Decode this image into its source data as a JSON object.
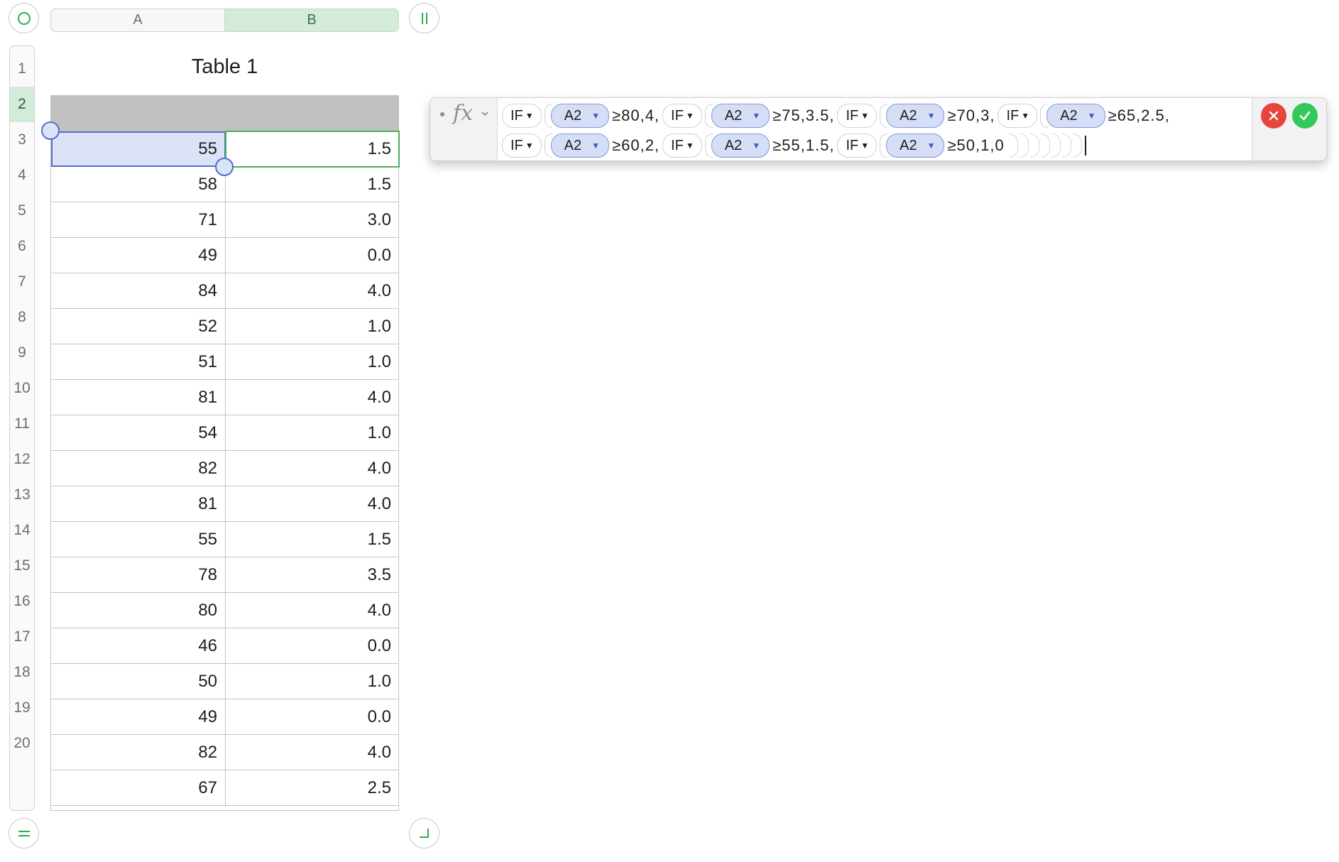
{
  "sheet": {
    "columns": [
      "A",
      "B"
    ],
    "selected_column": "B",
    "active_row": 2,
    "table_title": "Table 1",
    "row_numbers": [
      "1",
      "2",
      "3",
      "4",
      "5",
      "6",
      "7",
      "8",
      "9",
      "10",
      "11",
      "12",
      "13",
      "14",
      "15",
      "16",
      "17",
      "18",
      "19",
      "20"
    ],
    "rows": [
      {
        "a": "55",
        "b": "1.5"
      },
      {
        "a": "58",
        "b": "1.5"
      },
      {
        "a": "71",
        "b": "3.0"
      },
      {
        "a": "49",
        "b": "0.0"
      },
      {
        "a": "84",
        "b": "4.0"
      },
      {
        "a": "52",
        "b": "1.0"
      },
      {
        "a": "51",
        "b": "1.0"
      },
      {
        "a": "81",
        "b": "4.0"
      },
      {
        "a": "54",
        "b": "1.0"
      },
      {
        "a": "82",
        "b": "4.0"
      },
      {
        "a": "81",
        "b": "4.0"
      },
      {
        "a": "55",
        "b": "1.5"
      },
      {
        "a": "78",
        "b": "3.5"
      },
      {
        "a": "80",
        "b": "4.0"
      },
      {
        "a": "46",
        "b": "0.0"
      },
      {
        "a": "50",
        "b": "1.0"
      },
      {
        "a": "49",
        "b": "0.0"
      },
      {
        "a": "82",
        "b": "4.0"
      },
      {
        "a": "67",
        "b": "2.5"
      }
    ]
  },
  "formula": {
    "fx_label": "fx",
    "function_name": "IF",
    "reference": "A2",
    "line1": [
      {
        "fn": "IF",
        "ref": "A2",
        "text": "≥80,4,"
      },
      {
        "fn": "IF",
        "ref": "A2",
        "text": "≥75,3.5,"
      },
      {
        "fn": "IF",
        "ref": "A2",
        "text": "≥70,3,"
      },
      {
        "fn": "IF",
        "ref": "A2",
        "text": "≥65,2.5,"
      }
    ],
    "line2": [
      {
        "fn": "IF",
        "ref": "A2",
        "text": "≥60,2,"
      },
      {
        "fn": "IF",
        "ref": "A2",
        "text": "≥55,1.5,"
      },
      {
        "fn": "IF",
        "ref": "A2",
        "text": "≥50,1,0"
      }
    ],
    "closing_parens": 7
  },
  "colors": {
    "selection_blue": "#4f6ed0",
    "selection_green": "#4caf5c",
    "cancel_red": "#e5453b",
    "accept_green": "#34c759"
  }
}
